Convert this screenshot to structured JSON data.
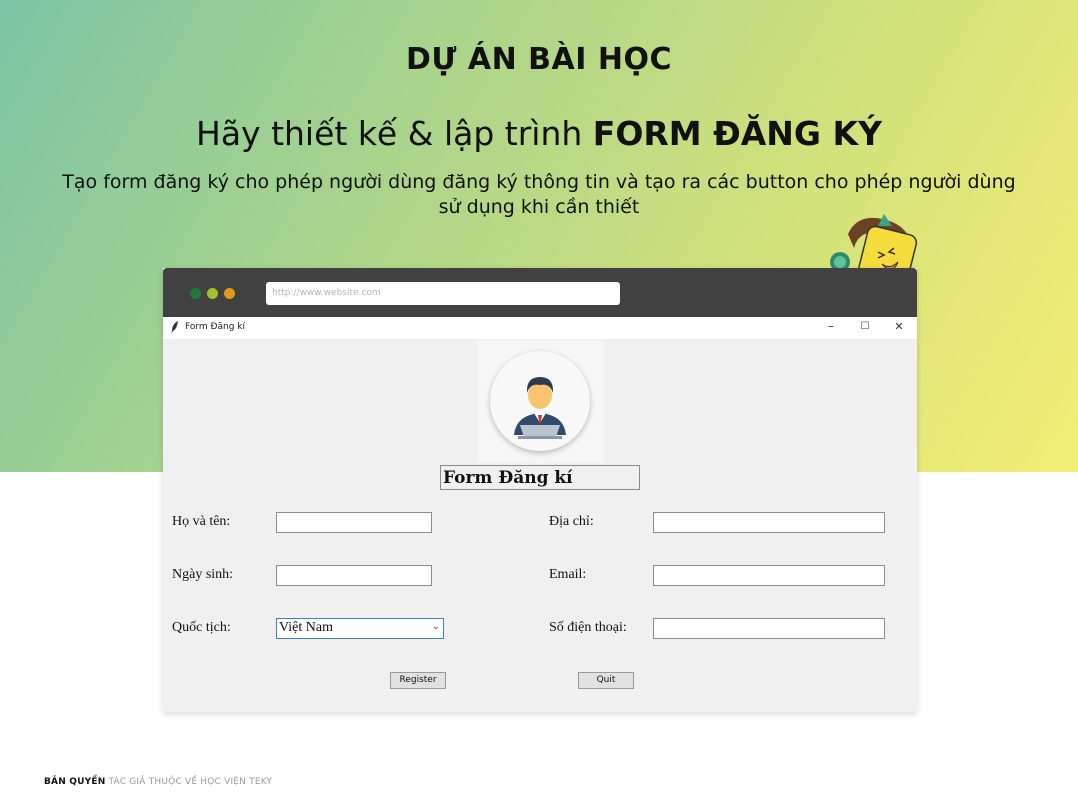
{
  "page": {
    "project_label": "DỰ ÁN BÀI HỌC",
    "headline_regular": "Hãy thiết kế & lập trình ",
    "headline_bold": "FORM ĐĂNG KÝ",
    "description": "Tạo form đăng ký cho phép người dùng đăng ký thông tin và tạo ra các button cho phép người dùng sử dụng khi cần thiết",
    "footer_bold": "BẢN QUYỀN",
    "footer_text": " TÁC GIẢ THUỘC VỀ HỌC VIỆN TEKY"
  },
  "browser": {
    "url_placeholder": "http://www.website.com",
    "dot_colors": [
      "#1f7a3a",
      "#a4c02d",
      "#e39a1a"
    ]
  },
  "window": {
    "title": "Form Đăng kí",
    "minimize_glyph": "–",
    "maximize_glyph": "☐",
    "close_glyph": "✕"
  },
  "form": {
    "heading": "Form Đăng kí",
    "labels": {
      "full_name": "Họ và tên:",
      "birth_date": "Ngày sinh:",
      "nationality": "Quốc tịch:",
      "address": "Địa chỉ:",
      "email": "Email:",
      "phone": "Số điện thoại:"
    },
    "values": {
      "full_name": "",
      "birth_date": "",
      "address": "",
      "email": "",
      "phone": ""
    },
    "nationality_selected": "Việt Nam",
    "register_label": "Register",
    "quit_label": "Quit"
  }
}
